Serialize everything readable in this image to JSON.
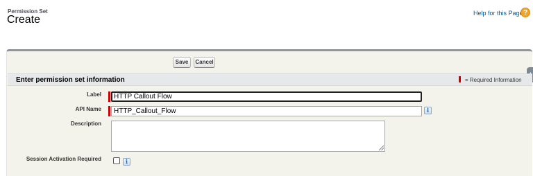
{
  "page_header": {
    "subtitle": "Permission Set",
    "title": "Create",
    "help_link": "Help for this Page",
    "help_icon_glyph": "?"
  },
  "toolbar": {
    "save_label": "Save",
    "cancel_label": "Cancel"
  },
  "section": {
    "title": "Enter permission set information",
    "required_legend": "= Required Information"
  },
  "form": {
    "label": {
      "caption": "Label",
      "value": "HTTP Callout Flow",
      "required": true
    },
    "api_name": {
      "caption": "API Name",
      "value": "HTTP_Callout_Flow",
      "required": true
    },
    "description": {
      "caption": "Description",
      "value": ""
    },
    "session_activation": {
      "caption": "Session Activation Required",
      "checked": false
    }
  },
  "icons": {
    "info_glyph": "i",
    "help_icon": "question-circle-icon",
    "info_icon": "info-icon"
  },
  "colors": {
    "required": "#cc0000",
    "link": "#015ba7",
    "help_icon": "#f0a62a",
    "panel_bg": "#f3f3ec",
    "section_bg": "#e7e8e9"
  }
}
